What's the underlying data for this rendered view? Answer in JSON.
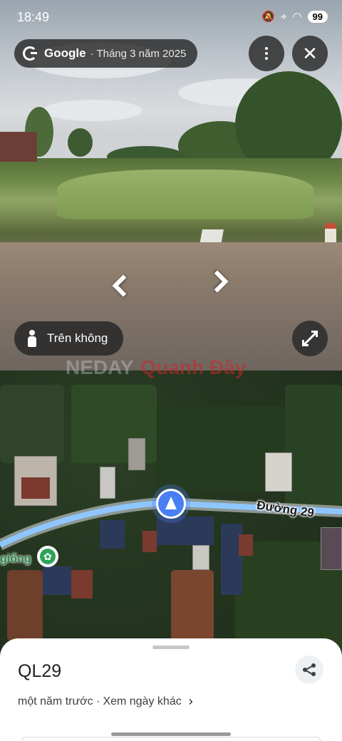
{
  "status_bar": {
    "time": "18:49",
    "battery": "99"
  },
  "header": {
    "brand": "Google",
    "date": "· Tháng 3 năm 2025"
  },
  "controls": {
    "aerial_label": "Trên không"
  },
  "map": {
    "road_label": "Đường 29",
    "place_label": "giống",
    "watermark_left": "NEDAY",
    "watermark_right": "Quanh Đây"
  },
  "sheet": {
    "title": "QL29",
    "time_ago": "một năm trước ·",
    "other_dates_link": "Xem ngày khác"
  },
  "colors": {
    "nav_blue": "#4a7ef5",
    "route_blue": "#8fc6ff",
    "place_green": "#2ea25a"
  }
}
